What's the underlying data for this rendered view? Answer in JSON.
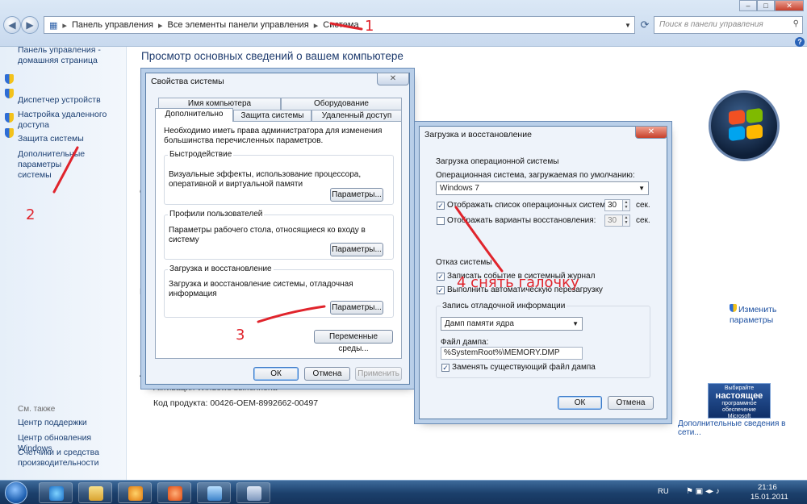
{
  "address_bar": {
    "path": [
      "Панель управления",
      "Все элементы панели управления",
      "Система"
    ],
    "search_placeholder": "Поиск в панели управления"
  },
  "left_nav": {
    "home": "Панель управления -\nдомашняя страница",
    "links": [
      "Диспетчер устройств",
      "Настройка удаленного\nдоступа",
      "Защита системы",
      "Дополнительные параметры\nсистемы"
    ],
    "see_also_title": "См. также",
    "see_also": [
      "Центр поддержки",
      "Центр обновления Windows",
      "Счетчики и средства\nпроизводительности"
    ]
  },
  "main": {
    "title": "Просмотр основных сведений о вашем компьютере",
    "change_settings": "Изменить\nпараметры",
    "activation": "Активация Windows выполнена",
    "product_key": "Код продукта: 00426-OEM-8992662-00497",
    "genuine_top": "Выбирайте",
    "genuine_big": "настоящее",
    "genuine_bottom": "программное обеспечение\nMicrosoft",
    "genuine_link": "Дополнительные сведения в сети..."
  },
  "sysprops": {
    "title": "Свойства системы",
    "tabs_back": [
      "Имя компьютера",
      "Оборудование"
    ],
    "tabs_front": [
      "Дополнительно",
      "Защита системы",
      "Удаленный доступ"
    ],
    "admin_note": "Необходимо иметь права администратора для изменения большинства перечисленных параметров.",
    "groups": [
      {
        "legend": "Быстродействие",
        "text": "Визуальные эффекты, использование процессора, оперативной и виртуальной памяти",
        "button": "Параметры..."
      },
      {
        "legend": "Профили пользователей",
        "text": "Параметры рабочего стола, относящиеся ко входу в систему",
        "button": "Параметры..."
      },
      {
        "legend": "Загрузка и восстановление",
        "text": "Загрузка и восстановление системы, отладочная информация",
        "button": "Параметры..."
      }
    ],
    "env_button": "Переменные среды...",
    "ok": "ОК",
    "cancel": "Отмена",
    "apply": "Применить"
  },
  "boot": {
    "title": "Загрузка и восстановление",
    "os_group": "Загрузка операционной системы",
    "default_os_label": "Операционная система, загружаемая по умолчанию:",
    "default_os": "Windows 7",
    "show_list": "Отображать список операционных систем:",
    "show_list_value": "30",
    "show_recovery": "Отображать варианты восстановления:",
    "show_recovery_value": "30",
    "seconds": "сек.",
    "failure_group": "Отказ системы",
    "write_event": "Записать событие в системный журнал",
    "auto_restart": "Выполнить автоматическую перезагрузку",
    "debug_group": "Запись отладочной информации",
    "dump_type": "Дамп памяти ядра",
    "dump_file_label": "Файл дампа:",
    "dump_file": "%SystemRoot%\\MEMORY.DMP",
    "overwrite": "Заменять существующий файл дампа",
    "ok": "ОК",
    "cancel": "Отмена"
  },
  "annotations": {
    "a1": "1",
    "a2": "2",
    "a3": "3",
    "a4": "4 снять галочку"
  },
  "taskbar": {
    "lang": "RU",
    "time": "21:16",
    "date": "15.01.2011"
  }
}
